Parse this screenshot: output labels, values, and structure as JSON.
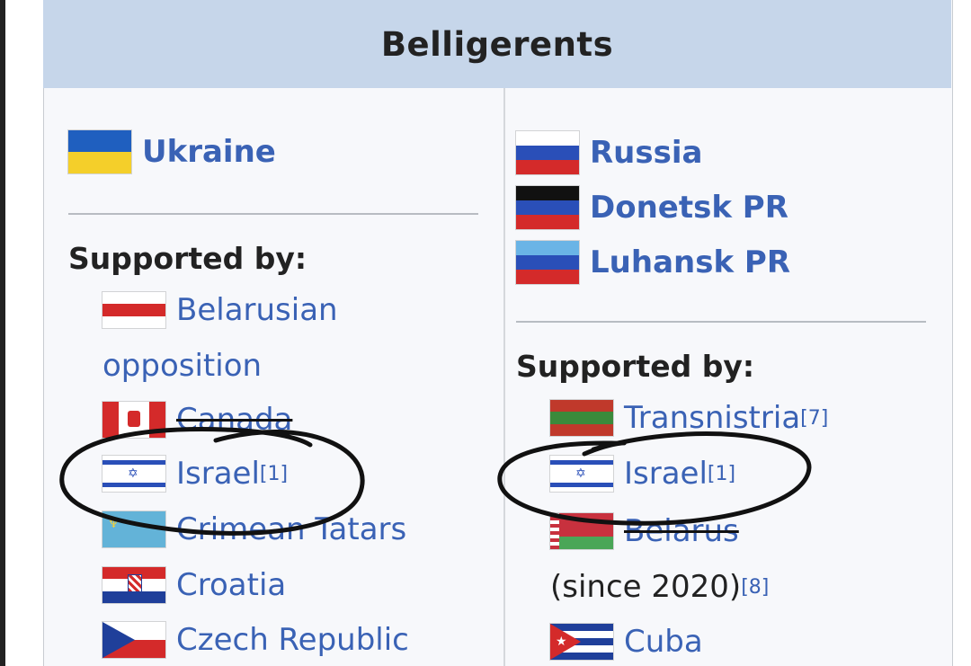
{
  "header": {
    "title": "Belligerents"
  },
  "left": {
    "primary": {
      "label": "Ukraine",
      "flag_icon": "ukraine-flag-icon"
    },
    "supported_label": "Supported by:",
    "supporters": [
      {
        "label": "Belarusian",
        "flag_icon": "belarus-opposition-flag-icon"
      },
      {
        "label": "opposition"
      },
      {
        "label": "Canada",
        "flag_icon": "canada-flag-icon"
      },
      {
        "label": "Israel",
        "ref": "[1]",
        "flag_icon": "israel-flag-icon"
      },
      {
        "label": "Crimean Tatars",
        "flag_icon": "crimean-tatar-flag-icon"
      },
      {
        "label": "Croatia",
        "flag_icon": "croatia-flag-icon"
      },
      {
        "label": "Czech Republic",
        "flag_icon": "czech-flag-icon"
      }
    ]
  },
  "right": {
    "primary": [
      {
        "label": "Russia",
        "flag_icon": "russia-flag-icon"
      },
      {
        "label": "Donetsk PR",
        "flag_icon": "donetsk-flag-icon"
      },
      {
        "label": "Luhansk PR",
        "flag_icon": "luhansk-flag-icon"
      }
    ],
    "supported_label": "Supported by:",
    "supporters": [
      {
        "label": "Transnistria",
        "ref": "[7]",
        "flag_icon": "transnistria-flag-icon"
      },
      {
        "label": "Israel",
        "ref": "[1]",
        "flag_icon": "israel-flag-icon"
      },
      {
        "label": "Belarus",
        "flag_icon": "belarus-flag-icon"
      },
      {
        "label": "(since 2020)",
        "ref": "[8]"
      },
      {
        "label": "Cuba",
        "flag_icon": "cuba-flag-icon"
      }
    ]
  },
  "colors": {
    "link": "#3a62b5",
    "header_bg": "#c6d6ea",
    "box_bg": "#f7f8fb",
    "ink": "#111111"
  }
}
